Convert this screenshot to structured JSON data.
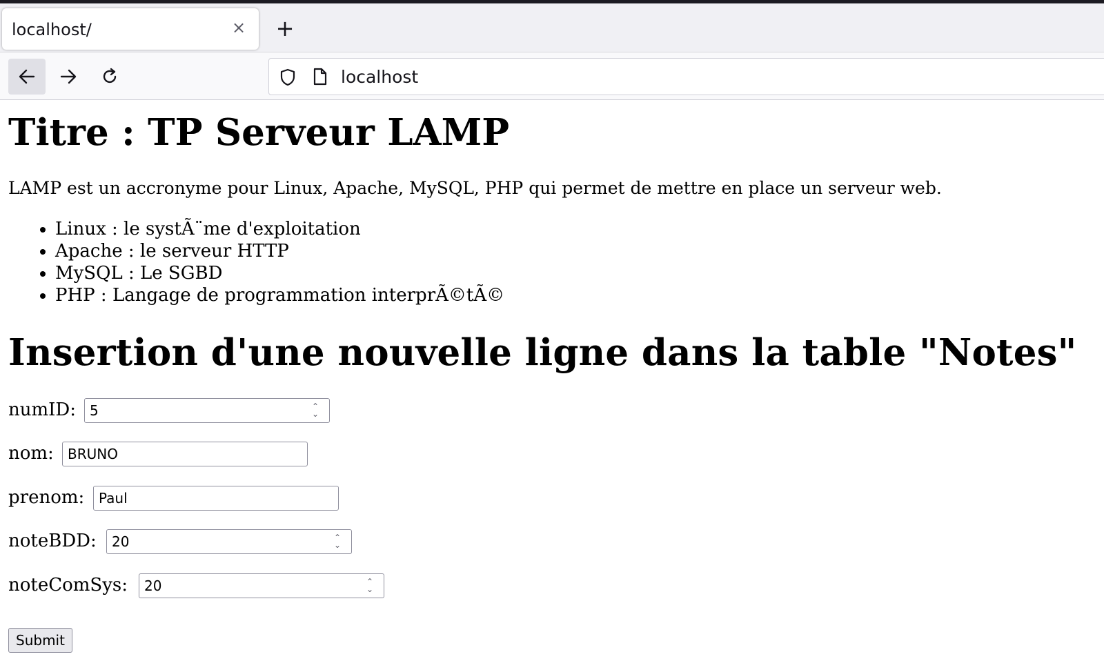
{
  "browser": {
    "tab_title": "localhost/",
    "tab_close": "×",
    "new_tab": "+",
    "url": "localhost"
  },
  "page": {
    "title": "Titre : TP Serveur LAMP",
    "intro": "LAMP est un accronyme pour Linux, Apache, MySQL, PHP qui permet de mettre en place un serveur web.",
    "list_items": [
      "Linux : le systÃ¨me d'exploitation",
      "Apache : le serveur HTTP",
      "MySQL : Le SGBD",
      "PHP : Langage de programmation interprÃ©tÃ©"
    ],
    "form_heading": "Insertion d'une nouvelle ligne dans la table \"Notes\"",
    "form": {
      "fields": [
        {
          "label": "numID:",
          "value": "5",
          "type": "number"
        },
        {
          "label": "nom:",
          "value": "BRUNO",
          "type": "text"
        },
        {
          "label": "prenom:",
          "value": "Paul",
          "type": "text"
        },
        {
          "label": "noteBDD:",
          "value": "20",
          "type": "number"
        },
        {
          "label": "noteComSys:",
          "value": "20",
          "type": "number"
        }
      ],
      "submit_label": "Submit"
    }
  }
}
